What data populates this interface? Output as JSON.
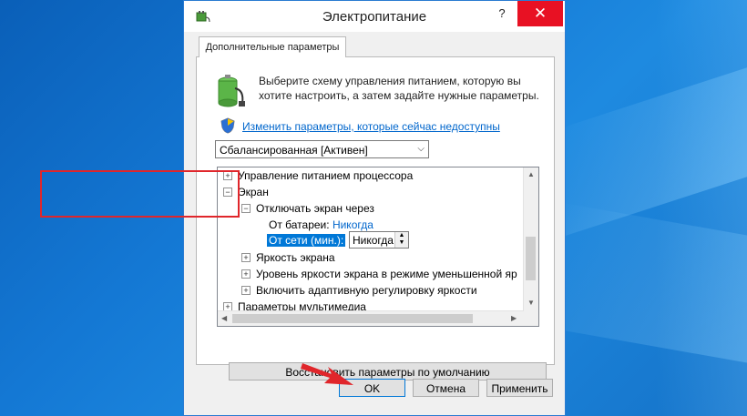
{
  "window": {
    "title": "Электропитание",
    "help": "?",
    "close": "✕"
  },
  "tab": {
    "label": "Дополнительные параметры"
  },
  "intro": {
    "text": "Выберите схему управления питанием, которую вы хотите настроить, а затем задайте нужные параметры."
  },
  "link": {
    "text": "Изменить параметры, которые сейчас недоступны"
  },
  "scheme_select": {
    "value": "Сбалансированная [Активен]"
  },
  "tree": {
    "cpu": "Управление питанием процессора",
    "screen": "Экран",
    "turn_off": "Отключать экран через",
    "battery_label": "От батареи:",
    "battery_value": "Никогда",
    "ac_label": "От сети (мин.):",
    "ac_value": "Никогда",
    "brightness": "Яркость экрана",
    "dim_brightness": "Уровень яркости экрана в режиме уменьшенной яр",
    "adaptive": "Включить адаптивную регулировку яркости",
    "multimedia": "Параметры мультимедиа"
  },
  "buttons": {
    "restore": "Восстановить параметры по умолчанию",
    "ok": "OK",
    "cancel": "Отмена",
    "apply": "Применить"
  },
  "colors": {
    "accent": "#0078d7",
    "highlight_box": "#e0262b",
    "close": "#e81123"
  }
}
